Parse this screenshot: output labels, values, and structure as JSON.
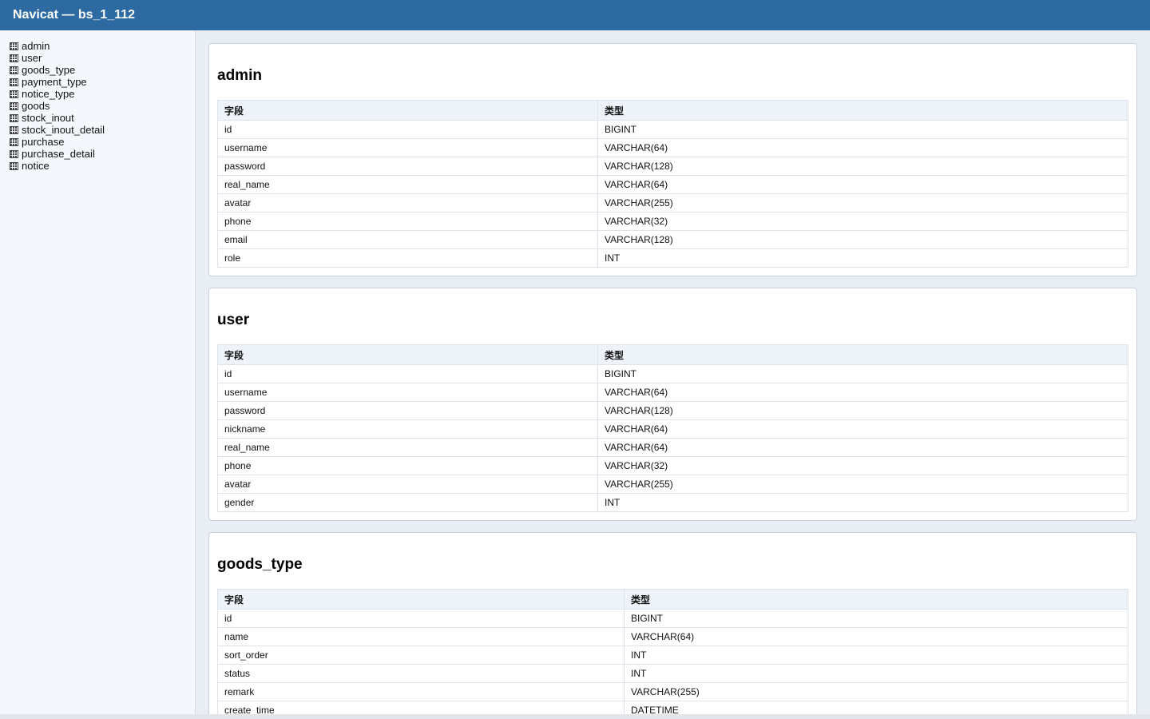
{
  "window": {
    "title": "Navicat — bs_1_112"
  },
  "sidebar": {
    "icon": "table-grid-icon",
    "items": [
      {
        "label": "admin"
      },
      {
        "label": "user"
      },
      {
        "label": "goods_type"
      },
      {
        "label": "payment_type"
      },
      {
        "label": "notice_type"
      },
      {
        "label": "goods"
      },
      {
        "label": "stock_inout"
      },
      {
        "label": "stock_inout_detail"
      },
      {
        "label": "purchase"
      },
      {
        "label": "purchase_detail"
      },
      {
        "label": "notice"
      }
    ]
  },
  "tables": [
    {
      "name": "admin",
      "headers": {
        "field": "字段",
        "type": "类型"
      },
      "rows": [
        {
          "field": "id",
          "type": "BIGINT"
        },
        {
          "field": "username",
          "type": "VARCHAR(64)"
        },
        {
          "field": "password",
          "type": "VARCHAR(128)"
        },
        {
          "field": "real_name",
          "type": "VARCHAR(64)"
        },
        {
          "field": "avatar",
          "type": "VARCHAR(255)"
        },
        {
          "field": "phone",
          "type": "VARCHAR(32)"
        },
        {
          "field": "email",
          "type": "VARCHAR(128)"
        },
        {
          "field": "role",
          "type": "INT"
        }
      ]
    },
    {
      "name": "user",
      "headers": {
        "field": "字段",
        "type": "类型"
      },
      "rows": [
        {
          "field": "id",
          "type": "BIGINT"
        },
        {
          "field": "username",
          "type": "VARCHAR(64)"
        },
        {
          "field": "password",
          "type": "VARCHAR(128)"
        },
        {
          "field": "nickname",
          "type": "VARCHAR(64)"
        },
        {
          "field": "real_name",
          "type": "VARCHAR(64)"
        },
        {
          "field": "phone",
          "type": "VARCHAR(32)"
        },
        {
          "field": "avatar",
          "type": "VARCHAR(255)"
        },
        {
          "field": "gender",
          "type": "INT"
        }
      ]
    },
    {
      "name": "goods_type",
      "headers": {
        "field": "字段",
        "type": "类型"
      },
      "rows": [
        {
          "field": "id",
          "type": "BIGINT"
        },
        {
          "field": "name",
          "type": "VARCHAR(64)"
        },
        {
          "field": "sort_order",
          "type": "INT"
        },
        {
          "field": "status",
          "type": "INT"
        },
        {
          "field": "remark",
          "type": "VARCHAR(255)"
        },
        {
          "field": "create_time",
          "type": "DATETIME"
        }
      ]
    }
  ]
}
